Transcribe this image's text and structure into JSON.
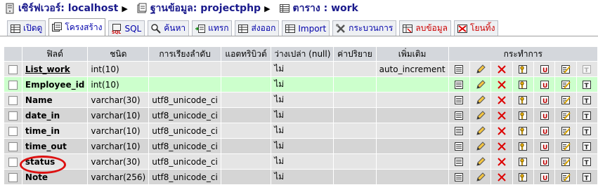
{
  "breadcrumb": {
    "server_label": "เซิร์ฟเวอร์: localhost",
    "db_label": "ฐานข้อมูล: projectphp",
    "table_label": "ตาราง : work"
  },
  "tabs": [
    {
      "label": "เปิดดู",
      "icon": "browse-icon"
    },
    {
      "label": "โครงสร้าง",
      "icon": "structure-icon",
      "active": true
    },
    {
      "label": "SQL",
      "icon": "sql-icon"
    },
    {
      "label": "ค้นหา",
      "icon": "search-icon"
    },
    {
      "label": "แทรก",
      "icon": "insert-icon"
    },
    {
      "label": "ส่งออก",
      "icon": "export-icon"
    },
    {
      "label": "Import",
      "icon": "import-icon"
    },
    {
      "label": "กระบวนการ",
      "icon": "operations-icon"
    },
    {
      "label": "ลบข้อมูล",
      "icon": "empty-icon",
      "danger": true
    },
    {
      "label": "โยนทิ้ง",
      "icon": "drop-icon",
      "danger": true
    }
  ],
  "table": {
    "headers": {
      "field": "ฟิลด์",
      "type": "ชนิด",
      "collation": "การเรียงลำดับ",
      "attributes": "แอตทริบิวต์",
      "null": "ว่างเปล่า (null)",
      "default": "ค่าปริยาย",
      "extra": "เพิ่มเติม",
      "actions": "กระทำการ"
    },
    "rows": [
      {
        "field": "List_work",
        "type": "int(10)",
        "collation": "",
        "attributes": "",
        "null": "ไม่",
        "default": "",
        "extra": "auto_increment",
        "primary": true
      },
      {
        "field": "Employee_id",
        "type": "int(10)",
        "collation": "",
        "attributes": "",
        "null": "ไม่",
        "default": "",
        "extra": "",
        "highlight": true
      },
      {
        "field": "Name",
        "type": "varchar(30)",
        "collation": "utf8_unicode_ci",
        "attributes": "",
        "null": "ไม่",
        "default": "",
        "extra": ""
      },
      {
        "field": "date_in",
        "type": "varchar(10)",
        "collation": "utf8_unicode_ci",
        "attributes": "",
        "null": "ไม่",
        "default": "",
        "extra": ""
      },
      {
        "field": "time_in",
        "type": "varchar(10)",
        "collation": "utf8_unicode_ci",
        "attributes": "",
        "null": "ไม่",
        "default": "",
        "extra": ""
      },
      {
        "field": "time_out",
        "type": "varchar(10)",
        "collation": "utf8_unicode_ci",
        "attributes": "",
        "null": "ไม่",
        "default": "",
        "extra": ""
      },
      {
        "field": "status",
        "type": "varchar(30)",
        "collation": "utf8_unicode_ci",
        "attributes": "",
        "null": "ไม่",
        "default": "",
        "extra": "",
        "circled": true
      },
      {
        "field": "Note",
        "type": "varchar(256)",
        "collation": "utf8_unicode_ci",
        "attributes": "",
        "null": "ไม่",
        "default": "",
        "extra": ""
      }
    ],
    "action_icons": [
      "browse-distinct-icon",
      "edit-pencil-icon",
      "drop-x-icon",
      "primary-key-icon",
      "unique-icon",
      "index-icon",
      "fulltext-icon"
    ]
  },
  "colors": {
    "link": "#1a1a8c",
    "header_bg": "#d4d7dc",
    "row_odd": "#e5e5e5",
    "row_even": "#d5d5d5",
    "row_highlight": "#ccffcc",
    "annotation": "#dd1111"
  }
}
